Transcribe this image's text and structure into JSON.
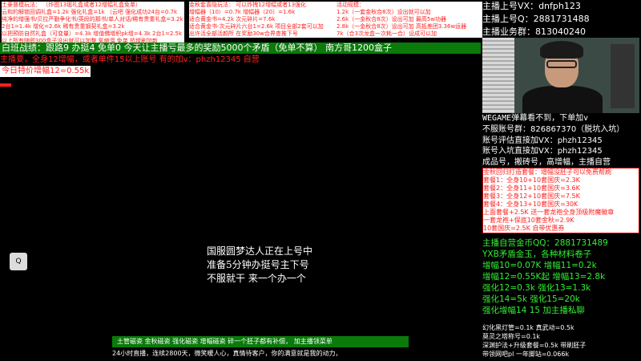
{
  "top_left": [
    "土豪督模玩法： （炸图13锻礼盒或者12增幅礼盒免单）",
    "云和的解锁回调礼盒=1.2k  强化礼盒=1k  （云吧 强化成功24台=0.7k",
    "纯净的增强书/贝拉严勤争化书/英段的那书/单人对话/稀有贵重礼盒=3.2k",
    "2台1=1.4k  增化=2.6k  稀有贵重钢契礼盒=3.2k",
    "以把预防自然礼盒（可变量）=4.3k  增值佛增积pk增=4.3k  2台1=2.5k",
    "以上所有随即300盒子没出就可以加整 氧缩溜 免单    抗增刷加新"
  ],
  "top_mid": [
    "金秋套喜隐玩法： 可以炸拽12增幅或者13强化",
    "增幅器（10）=0.7k    增幅器（20）=1.6k",
    "适合黄金书=4.2k        次元碎片=7.6k",
    "适合黄金书-次元碎片六台1=2.6k 项目全部2套可以加",
    "出许活全部活颜所 在奖励30w合界查推下号"
  ],
  "top_right": [
    "活动规模：",
    "1.2k（一套金秋合8次）设出就可以加",
    "2.6k（一金秋合8次）设出可加 最高5w功器",
    "2.8k（一金秋合8次）设出可加 高抵差团3.36w运器",
    "7k（合3次龙盒一次耗一合）设成可以加"
  ],
  "banner": "白班战绩：跟路9  办挺4  免单0   今天让主播亏最多的奖励5000个矛盾（免单不算）  南方哥1200盒子",
  "line2": "主播要，全身12增幅，或者单件15以上账号  有的加v：phzh12345  自营",
  "line3": "今日特价增幅12=0.55k",
  "center_text": [
    "国服圆梦达人正在上号中",
    "准备5分钟办挺号主下号",
    "不服就干 来一个办一个"
  ],
  "logo_label": "Q",
  "bottom_green": "土管磁瓷 金秋磁瓷  强化磁瓷  增幅磁瓷  碎一个胚子都有补偿， 加主播领菜单",
  "bottom_white": "24小时直播，连续2800天，微笑暖人心，真情待客户，你的满意就是我的动力，",
  "right_top": [
    {
      "label": "主播上号VX：",
      "value": "dnfph123"
    },
    {
      "label": "主播上号Q：",
      "value": "2881731488"
    },
    {
      "label": "主播业务群：",
      "value": "813040240"
    }
  ],
  "wegame": "WEGAME弹幕看不到，下单加v",
  "info": [
    "不服账号群：826867370（脱坑入坑）",
    "账号评估直接加VX：phzh12345",
    "账号入坑直接加VX：phzh12345",
    "成品号，搬砖号，高增幅，主播自营"
  ],
  "red_box": [
    "金秋回归打造套餐：增幅没胚子可以免费帮刷",
    "套餐1：全身10+10套国庆=2.3K",
    "套餐2：全身11+10套国庆=3.6K",
    "套餐3：全身12+10套国庆=7.5K",
    "套餐4：全身13+10套国庆=30K",
    "上面套餐+2.5K  送一套龙袍全身顶级附魔徽章",
    "一套龙袍+保底10套金秋=2.9K",
    "10套国庆=2.5K  自带优惠券"
  ],
  "green_block": [
    "主播自营金币QQ：2881731489",
    "YXB矛盾金玉，各种材料卷子",
    "增幅10=0.07K    增幅11=0.2k",
    "增幅12=0.55K起  增幅13=2.8k",
    "强化12=0.3k      强化13=1.3k",
    "强化14=5k          强化15=20k",
    "强化增幅14  15   加主播私聊"
  ],
  "bottom_right": [
    "幻化黑灯管=0.1k  真武动=0.5k",
    "        莫灵之塔称号=0.1k",
    "深渊护法+升级套餐=0.5k  带刷胚子",
    "带领网吧pl     一年脚站=0.066k"
  ]
}
